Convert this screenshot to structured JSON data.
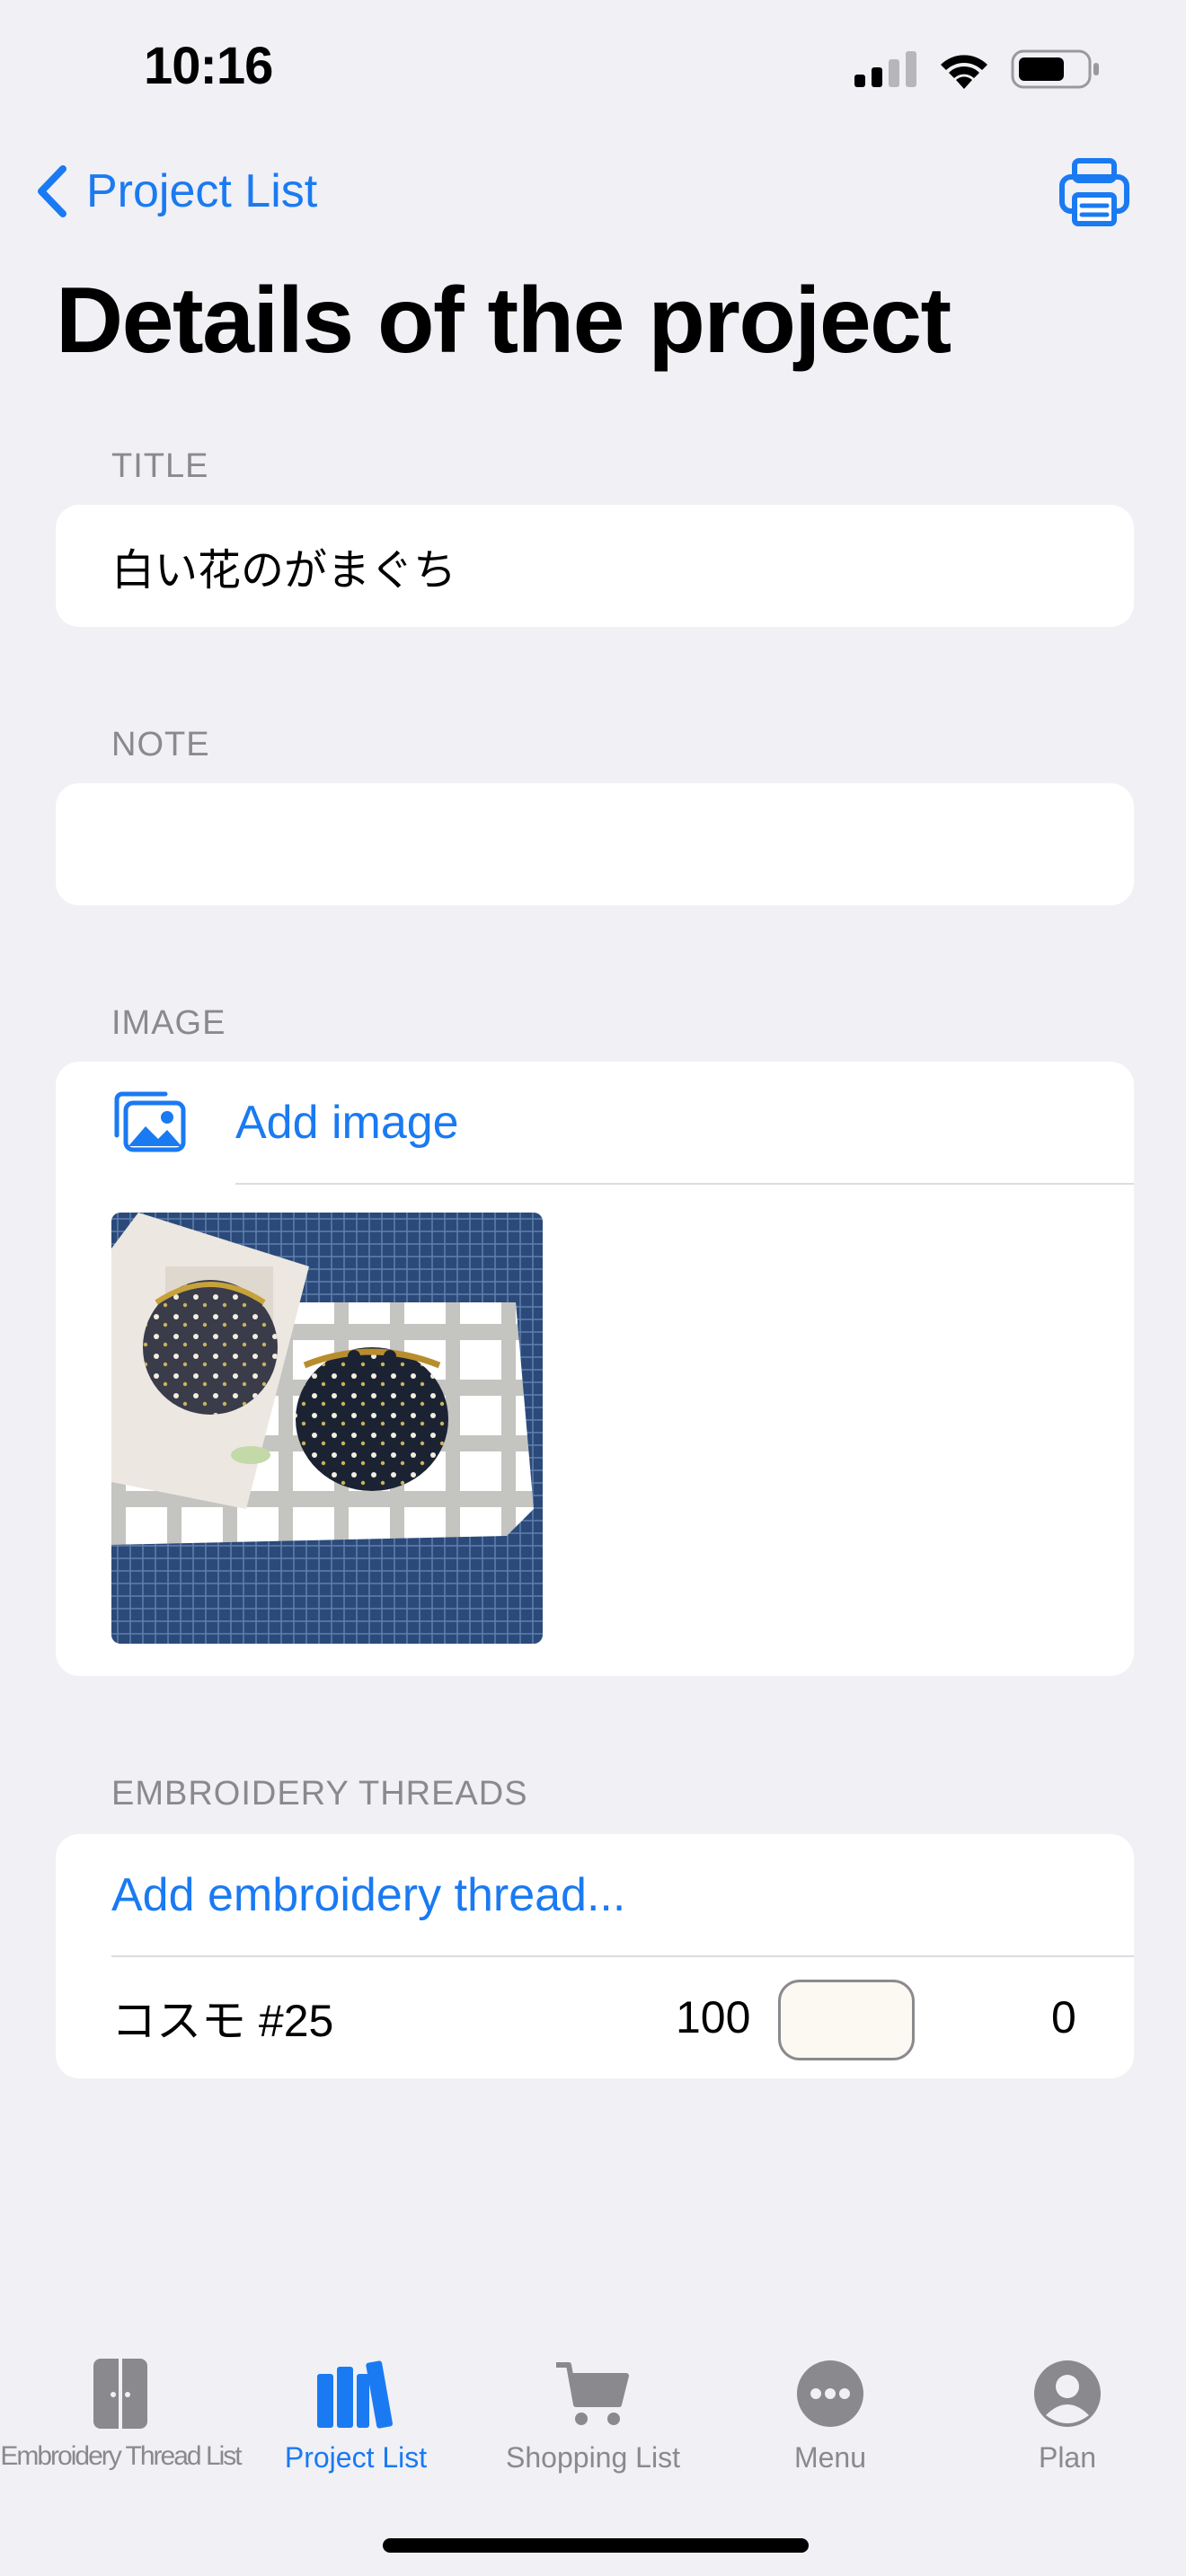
{
  "status_bar": {
    "time": "10:16"
  },
  "nav": {
    "back_label": "Project List"
  },
  "page": {
    "title": "Details of the project"
  },
  "sections": {
    "title": {
      "label": "TITLE",
      "value": "白い花のがまぐち"
    },
    "note": {
      "label": "NOTE",
      "value": ""
    },
    "image": {
      "label": "IMAGE",
      "add_label": "Add image"
    },
    "threads": {
      "label": "EMBROIDERY THREADS",
      "add_label": "Add embroidery thread...",
      "items": [
        {
          "name": "コスモ  #25",
          "number": "100",
          "swatch_color": "#fcf8f2",
          "count": "0"
        }
      ]
    }
  },
  "tabs": [
    {
      "label": "Embroidery Thread List",
      "icon": "thread-box-icon"
    },
    {
      "label": "Project List",
      "icon": "books-icon",
      "active": true
    },
    {
      "label": "Shopping List",
      "icon": "cart-icon"
    },
    {
      "label": "Menu",
      "icon": "ellipsis-circle-icon"
    },
    {
      "label": "Plan",
      "icon": "person-circle-icon"
    }
  ],
  "colors": {
    "accent": "#1a7af2",
    "background": "#f0f0f5",
    "secondary_text": "#8a8a8e"
  }
}
